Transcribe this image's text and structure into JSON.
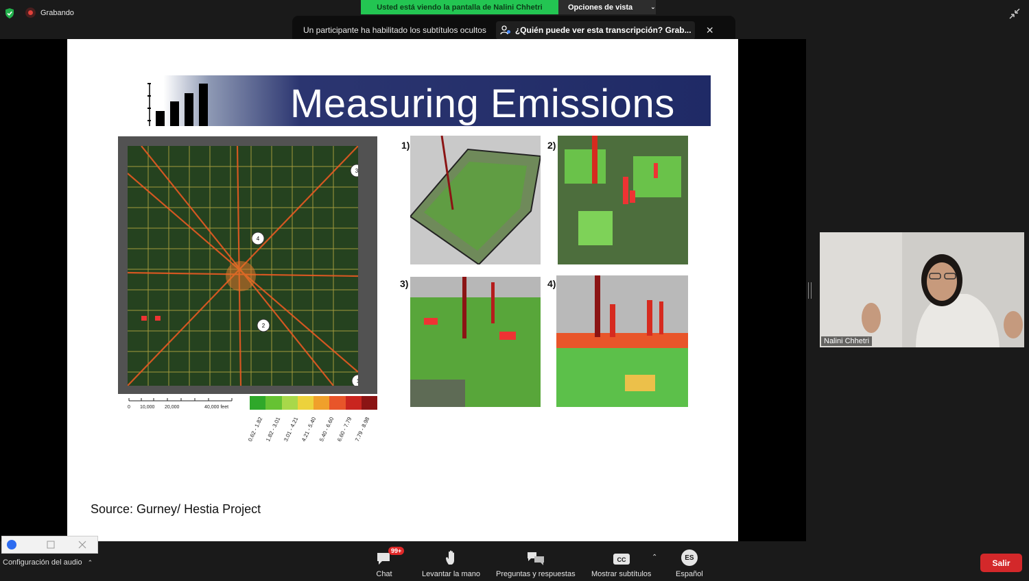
{
  "topbar": {
    "recording_label": "Grabando",
    "share_banner": "Usted está viendo la pantalla de Nalini Chhetri",
    "view_options_label": "Opciones de vista"
  },
  "captions": {
    "notice": "Un participante ha habilitado los subtítulos ocultos",
    "link": "¿Quién puede ver esta transcripción? Grab..."
  },
  "slide": {
    "title": "Measuring Emissions",
    "panels": [
      "1)",
      "2)",
      "3)",
      "4)"
    ],
    "map_markers": [
      "1",
      "2",
      "3",
      "4"
    ],
    "scale_labels": [
      "0",
      "10,000",
      "20,000",
      "40,000 feet"
    ],
    "legend_colors": [
      "#2fa82a",
      "#66c233",
      "#a8d84a",
      "#ecd23c",
      "#f0a02b",
      "#e8552a",
      "#c9251f",
      "#8b1414"
    ],
    "legend_labels": [
      "0.62 - 1.82",
      "1.82 - 3.01",
      "3.01 - 4.21",
      "4.21 - 5.40",
      "5.40 - 6.60",
      "6.60 - 7.79",
      "7.79 - 8.98"
    ],
    "source": "Source: Gurney/ Hestia Project"
  },
  "video": {
    "participant_name": "Nalini Chhetri"
  },
  "bottom": {
    "audio_settings": "Configuración del audio",
    "chat_badge": "99+",
    "items": [
      {
        "label": "Chat",
        "icon": "chat-icon"
      },
      {
        "label": "Levantar la mano",
        "icon": "hand-icon"
      },
      {
        "label": "Preguntas y respuestas",
        "icon": "qa-icon"
      },
      {
        "label": "Mostrar subtítulos",
        "icon": "cc-icon"
      },
      {
        "label": "Español",
        "icon": "language-icon",
        "abbr": "ES"
      }
    ],
    "leave_label": "Salir"
  }
}
